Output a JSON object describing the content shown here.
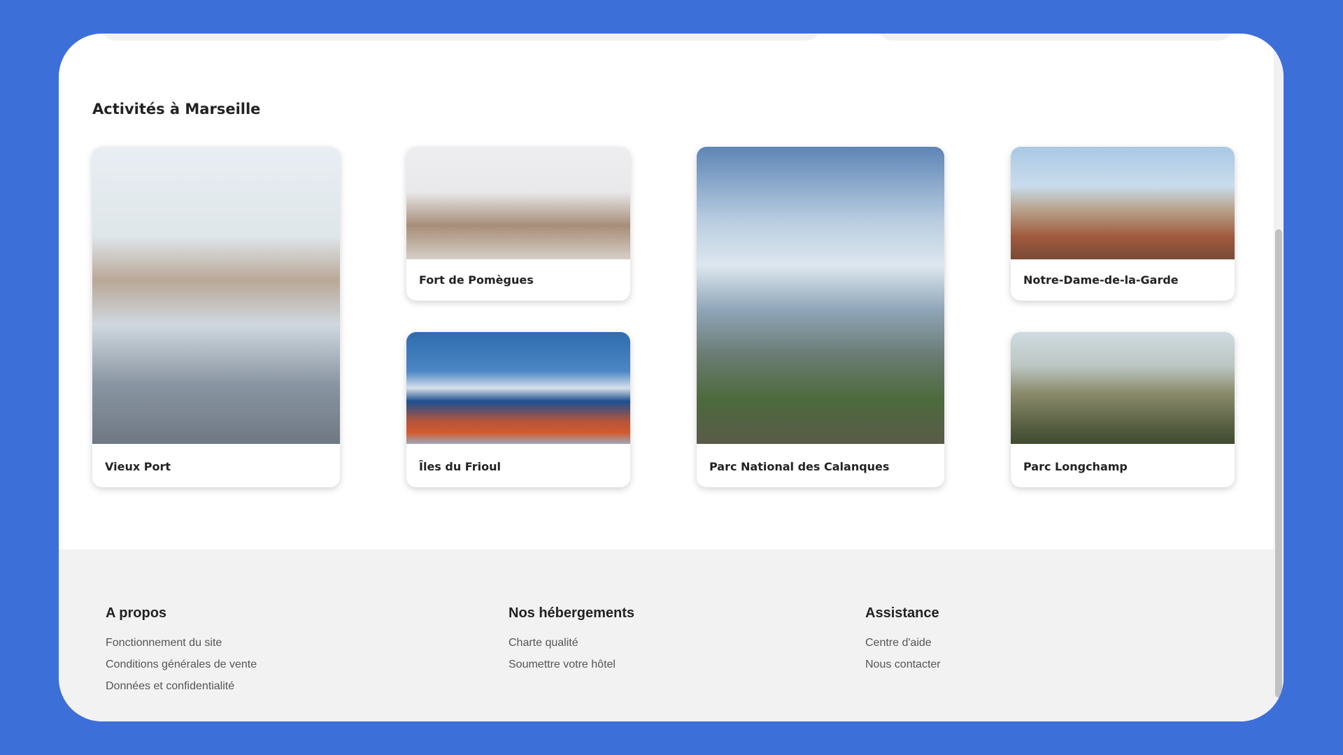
{
  "section": {
    "title": "Activités à Marseille"
  },
  "cards": [
    {
      "label": "Vieux Port",
      "image": "vieux-port-photo"
    },
    {
      "label": "Fort de Pomègues",
      "image": "fort-de-pomegues-photo"
    },
    {
      "label": "Îles du Frioul",
      "image": "iles-du-frioul-photo"
    },
    {
      "label": "Parc National des Calanques",
      "image": "calanques-photo"
    },
    {
      "label": "Notre-Dame-de-la-Garde",
      "image": "notre-dame-photo"
    },
    {
      "label": "Parc Longchamp",
      "image": "parc-longchamp-photo"
    }
  ],
  "footer": {
    "columns": [
      {
        "title": "A propos",
        "links": [
          "Fonctionnement du site",
          "Conditions générales de vente",
          "Données et confidentialité"
        ]
      },
      {
        "title": "Nos hébergements",
        "links": [
          "Charte qualité",
          "Soumettre votre hôtel"
        ]
      },
      {
        "title": "Assistance",
        "links": [
          "Centre d'aide",
          "Nous contacter"
        ]
      }
    ]
  },
  "colors": {
    "background": "#3d6fd8",
    "card_bg": "#ffffff",
    "footer_bg": "#f2f2f2"
  }
}
